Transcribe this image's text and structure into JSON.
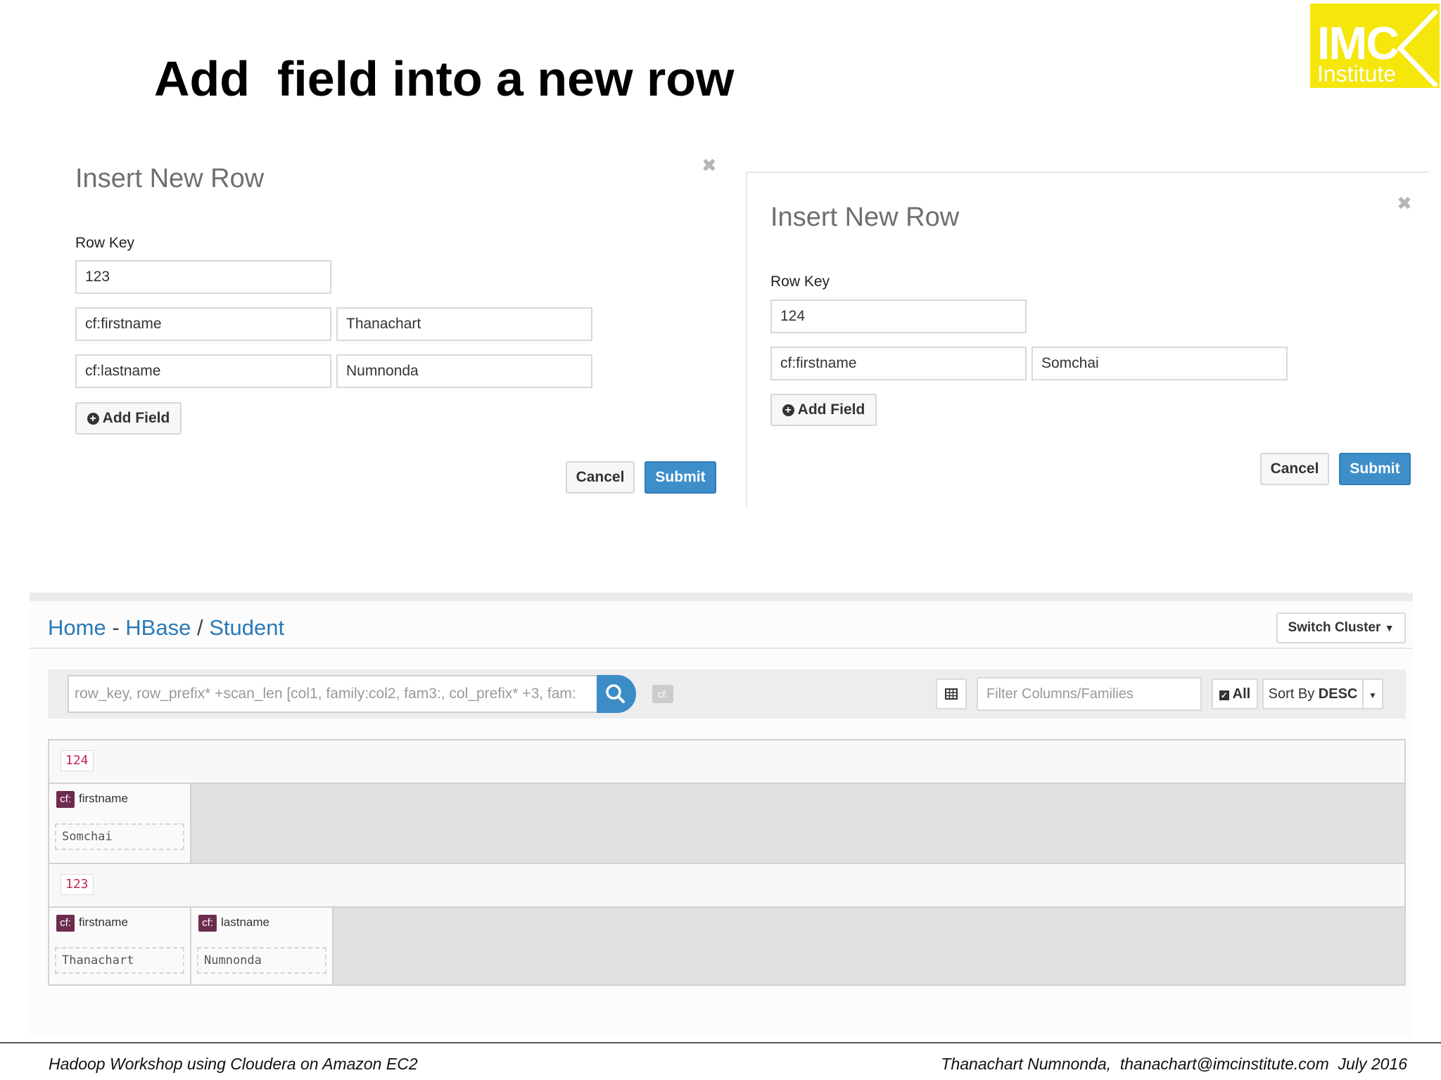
{
  "slide": {
    "title": "Add  field into a new row",
    "logo": {
      "line1": "IMC",
      "line2": "Institute"
    }
  },
  "modal_left": {
    "title": "Insert New Row",
    "row_key_label": "Row Key",
    "row_key_value": "123",
    "fields": [
      {
        "column": "cf:firstname",
        "value": "Thanachart"
      },
      {
        "column": "cf:lastname",
        "value": "Numnonda"
      }
    ],
    "add_field_label": "Add Field",
    "cancel_label": "Cancel",
    "submit_label": "Submit"
  },
  "modal_right": {
    "title": "Insert New Row",
    "row_key_label": "Row Key",
    "row_key_value": "124",
    "fields": [
      {
        "column": "cf:firstname",
        "value": "Somchai"
      }
    ],
    "add_field_label": "Add Field",
    "cancel_label": "Cancel",
    "submit_label": "Submit"
  },
  "hbase": {
    "breadcrumb": {
      "home": "Home",
      "sep1": "-",
      "hbase": "HBase",
      "sep2": "/",
      "table": "Student"
    },
    "switch_cluster": "Switch Cluster",
    "search_placeholder": "row_key, row_prefix* +scan_len [col1, family:col2, fam3:, col_prefix* +3, fam:",
    "cf_badge": "cf:",
    "filter_placeholder": "Filter Columns/Families",
    "all_label": "All",
    "sort_label": "Sort By",
    "sort_value": "DESC",
    "rows": [
      {
        "key": "124",
        "cells": [
          {
            "family": "cf:",
            "column": "firstname",
            "value": "Somchai"
          }
        ]
      },
      {
        "key": "123",
        "cells": [
          {
            "family": "cf:",
            "column": "firstname",
            "value": "Thanachart"
          },
          {
            "family": "cf:",
            "column": "lastname",
            "value": "Numnonda"
          }
        ]
      }
    ]
  },
  "footer": {
    "left": "Hadoop Workshop using Cloudera on Amazon EC2",
    "right": "Thanachart Numnonda,  thanachart@imcinstitute.com  July 2016"
  },
  "colors": {
    "primary": "#3d8ec9",
    "link": "#2a7ab5",
    "row_key": "#c7254e",
    "cf_tag": "#6d2c4e",
    "logo": "#f5e60b"
  }
}
